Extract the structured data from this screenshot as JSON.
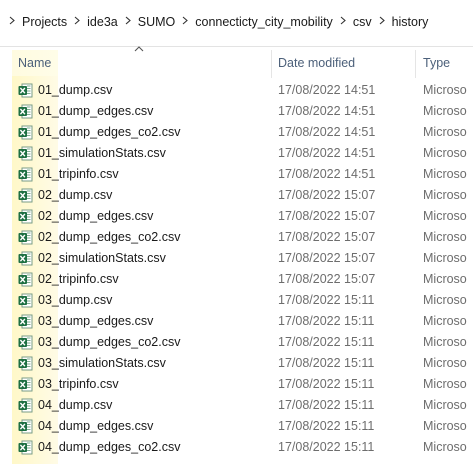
{
  "breadcrumb": {
    "items": [
      "Projects",
      "ide3a",
      "SUMO",
      "connecticty_city_mobility",
      "csv",
      "history"
    ]
  },
  "columns": {
    "name": "Name",
    "date_modified": "Date modified",
    "type": "Type"
  },
  "files": [
    {
      "name": "01_dump.csv",
      "date": "17/08/2022 14:51",
      "type": "Microso"
    },
    {
      "name": "01_dump_edges.csv",
      "date": "17/08/2022 14:51",
      "type": "Microso"
    },
    {
      "name": "01_dump_edges_co2.csv",
      "date": "17/08/2022 14:51",
      "type": "Microso"
    },
    {
      "name": "01_simulationStats.csv",
      "date": "17/08/2022 14:51",
      "type": "Microso"
    },
    {
      "name": "01_tripinfo.csv",
      "date": "17/08/2022 14:51",
      "type": "Microso"
    },
    {
      "name": "02_dump.csv",
      "date": "17/08/2022 15:07",
      "type": "Microso"
    },
    {
      "name": "02_dump_edges.csv",
      "date": "17/08/2022 15:07",
      "type": "Microso"
    },
    {
      "name": "02_dump_edges_co2.csv",
      "date": "17/08/2022 15:07",
      "type": "Microso"
    },
    {
      "name": "02_simulationStats.csv",
      "date": "17/08/2022 15:07",
      "type": "Microso"
    },
    {
      "name": "02_tripinfo.csv",
      "date": "17/08/2022 15:07",
      "type": "Microso"
    },
    {
      "name": "03_dump.csv",
      "date": "17/08/2022 15:11",
      "type": "Microso"
    },
    {
      "name": "03_dump_edges.csv",
      "date": "17/08/2022 15:11",
      "type": "Microso"
    },
    {
      "name": "03_dump_edges_co2.csv",
      "date": "17/08/2022 15:11",
      "type": "Microso"
    },
    {
      "name": "03_simulationStats.csv",
      "date": "17/08/2022 15:11",
      "type": "Microso"
    },
    {
      "name": "03_tripinfo.csv",
      "date": "17/08/2022 15:11",
      "type": "Microso"
    },
    {
      "name": "04_dump.csv",
      "date": "17/08/2022 15:11",
      "type": "Microso"
    },
    {
      "name": "04_dump_edges.csv",
      "date": "17/08/2022 15:11",
      "type": "Microso"
    },
    {
      "name": "04_dump_edges_co2.csv",
      "date": "17/08/2022 15:11",
      "type": "Microso"
    }
  ],
  "icons": {
    "file": "excel-csv-file-icon",
    "separator": "chevron-right-icon",
    "sort": "sort-ascending-caret-icon"
  },
  "colors": {
    "header_text": "#4c607a",
    "secondary_text": "#6d6d6d",
    "excel_green": "#1d6f42",
    "highlight": "#fff8c8"
  }
}
